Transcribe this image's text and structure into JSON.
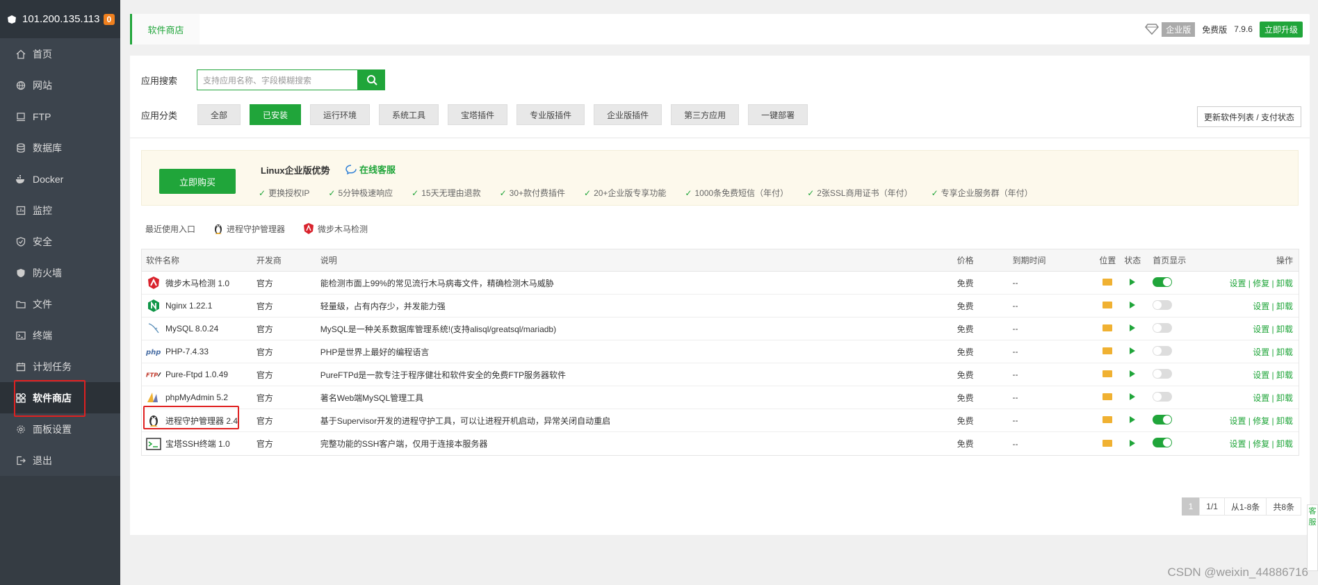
{
  "sidebar": {
    "ip": "101.200.135.113",
    "badge": "0",
    "items": [
      {
        "label": "首页",
        "icon": "home-icon"
      },
      {
        "label": "网站",
        "icon": "globe-icon"
      },
      {
        "label": "FTP",
        "icon": "ftp-icon"
      },
      {
        "label": "数据库",
        "icon": "database-icon"
      },
      {
        "label": "Docker",
        "icon": "docker-icon"
      },
      {
        "label": "监控",
        "icon": "monitor-icon"
      },
      {
        "label": "安全",
        "icon": "shield-icon"
      },
      {
        "label": "防火墙",
        "icon": "firewall-icon"
      },
      {
        "label": "文件",
        "icon": "folder-icon"
      },
      {
        "label": "终端",
        "icon": "terminal-icon"
      },
      {
        "label": "计划任务",
        "icon": "calendar-icon"
      },
      {
        "label": "软件商店",
        "icon": "apps-icon"
      },
      {
        "label": "面板设置",
        "icon": "gear-icon"
      },
      {
        "label": "退出",
        "icon": "logout-icon"
      }
    ]
  },
  "topbar": {
    "tab": "软件商店",
    "enterprise": "企业版",
    "free": "免费版",
    "version": "7.9.6",
    "upgrade": "立即升级"
  },
  "search": {
    "label": "应用搜索",
    "placeholder": "支持应用名称、字段模糊搜索"
  },
  "categories": {
    "label": "应用分类",
    "items": [
      "全部",
      "已安装",
      "运行环境",
      "系统工具",
      "宝塔插件",
      "专业版插件",
      "企业版插件",
      "第三方应用",
      "一键部署"
    ],
    "active": "已安装",
    "update_button": "更新软件列表 / 支付状态"
  },
  "promo": {
    "buy": "立即购买",
    "title": "Linux企业版优势",
    "service": "在线客服",
    "features": [
      "更换授权IP",
      "5分钟极速响应",
      "15天无理由退款",
      "30+款付费插件",
      "20+企业版专享功能",
      "1000条免费短信（年付）",
      "2张SSL商用证书（年付）",
      "专享企业服务群（年付）"
    ]
  },
  "recent": {
    "label": "最近使用入口",
    "items": [
      "进程守护管理器",
      "微步木马检测"
    ]
  },
  "table": {
    "headers": [
      "软件名称",
      "开发商",
      "说明",
      "价格",
      "到期时间",
      "位置",
      "状态",
      "首页显示",
      "操作"
    ],
    "rows": [
      {
        "name": "微步木马检测 1.0",
        "dev": "官方",
        "desc": "能检测市面上99%的常见流行木马病毒文件，精确检测木马威胁",
        "price": "免费",
        "expire": "--",
        "home": true,
        "ops": "设置 | 修复 | 卸载",
        "icon": "trojan-icon"
      },
      {
        "name": "Nginx 1.22.1",
        "dev": "官方",
        "desc": "轻量级，占有内存少，并发能力强",
        "price": "免费",
        "expire": "--",
        "home": false,
        "ops": "设置 | 卸载",
        "icon": "nginx-icon"
      },
      {
        "name": "MySQL 8.0.24",
        "dev": "官方",
        "desc": "MySQL是一种关系数据库管理系统!(支持alisql/greatsql/mariadb)",
        "price": "免费",
        "expire": "--",
        "home": false,
        "ops": "设置 | 卸载",
        "icon": "mysql-icon"
      },
      {
        "name": "PHP-7.4.33",
        "dev": "官方",
        "desc": "PHP是世界上最好的编程语言",
        "price": "免费",
        "expire": "--",
        "home": false,
        "ops": "设置 | 卸载",
        "icon": "php-icon"
      },
      {
        "name": "Pure-Ftpd 1.0.49",
        "dev": "官方",
        "desc": "PureFTPd是一款专注于程序健壮和软件安全的免费FTP服务器软件",
        "price": "免费",
        "expire": "--",
        "home": false,
        "ops": "设置 | 卸载",
        "icon": "ftp-icon"
      },
      {
        "name": "phpMyAdmin 5.2",
        "dev": "官方",
        "desc": "著名Web端MySQL管理工具",
        "price": "免费",
        "expire": "--",
        "home": false,
        "ops": "设置 | 卸载",
        "icon": "phpmyadmin-icon"
      },
      {
        "name": "进程守护管理器 2.4",
        "dev": "官方",
        "desc": "基于Supervisor开发的进程守护工具，可以让进程开机启动，异常关闭自动重启",
        "price": "免费",
        "expire": "--",
        "home": true,
        "ops": "设置 | 修复 | 卸载",
        "icon": "penguin-icon"
      },
      {
        "name": "宝塔SSH终端 1.0",
        "dev": "官方",
        "desc": "完整功能的SSH客户端，仅用于连接本服务器",
        "price": "免费",
        "expire": "--",
        "home": true,
        "ops": "设置 | 修复 | 卸载",
        "icon": "terminal-icon"
      }
    ]
  },
  "pager": {
    "current": "1",
    "pages": "1/1",
    "range": "从1-8条",
    "total": "共8条"
  },
  "watermark": "CSDN @weixin_44886716",
  "float_label": "客服"
}
